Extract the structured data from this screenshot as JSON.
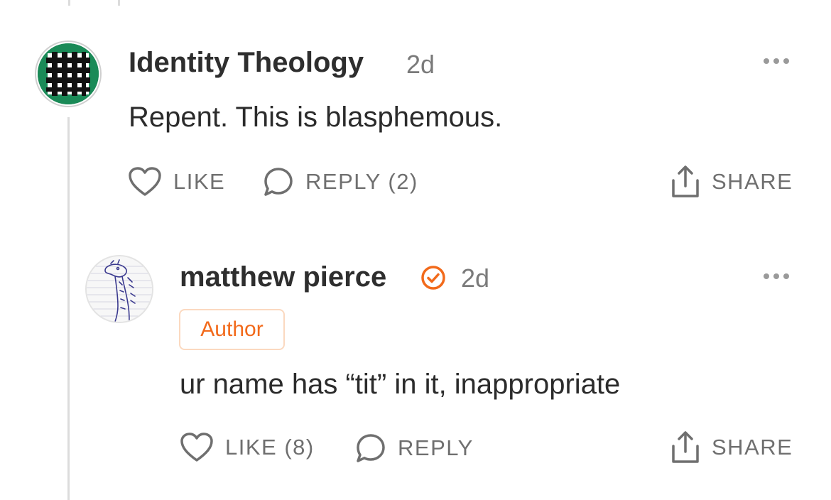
{
  "comments": [
    {
      "author": "Identity Theology",
      "time": "2d",
      "body": "Repent. This is blasphemous.",
      "actions": {
        "like": "LIKE",
        "reply": "REPLY (2)",
        "share": "SHARE"
      },
      "avatar": "green-grid-avatar"
    },
    {
      "author": "matthew pierce",
      "verified": true,
      "time": "2d",
      "badge": "Author",
      "body": "ur name has “tit” in it, inappropriate",
      "actions": {
        "like": "LIKE (8)",
        "reply": "REPLY",
        "share": "SHARE"
      },
      "avatar": "giraffe-sketch-avatar"
    }
  ],
  "colors": {
    "accent": "#f26a1b",
    "badge_border": "#fbd9c0",
    "avatar_green": "#1a8a57",
    "action_gray": "#6f6f6f",
    "thread_line": "#dcdcdc"
  },
  "icons": {
    "like": "heart-icon",
    "reply": "speech-bubble-icon",
    "share": "share-upload-icon",
    "more": "more-dots-icon",
    "verified": "verified-check-icon"
  }
}
